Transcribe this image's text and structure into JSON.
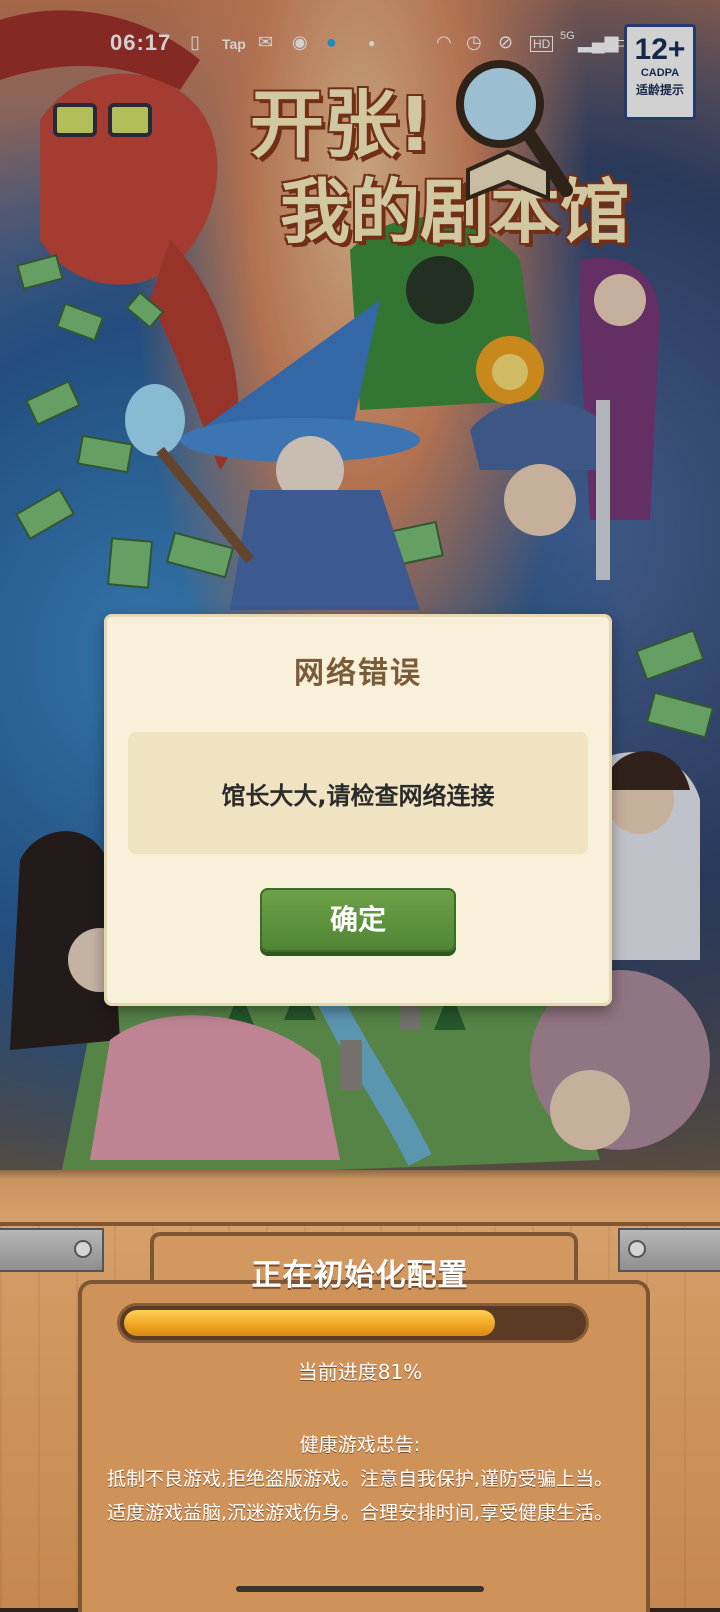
{
  "status_bar": {
    "time": "06:17",
    "left_icons": [
      "listen-app-icon",
      "taptap-icon",
      "wechat-icon",
      "browser-icon",
      "qq-icon",
      "dot-icon"
    ],
    "tap_label": "Tap",
    "right_icons": [
      "headphones-icon",
      "alarm-icon",
      "mute-icon",
      "hd-icon",
      "5g-signal-icon",
      "battery-icon"
    ],
    "hd_label": "HD",
    "network_label": "5G"
  },
  "age_badge": {
    "rating": "12+",
    "org": "CADPA",
    "tip": "适龄提示"
  },
  "game_title": {
    "line1": "开张!",
    "line2": "我的剧本馆"
  },
  "dialog": {
    "title": "网络错误",
    "message": "馆长大大,请检查网络连接",
    "confirm_label": "确定"
  },
  "loading": {
    "title": "正在初始化配置",
    "progress": 0.81,
    "progress_text": "当前进度81%",
    "advice_title": "健康游戏忠告:",
    "advice_line1": "抵制不良游戏,拒绝盗版游戏。注意自我保护,谨防受骗上当。",
    "advice_line2": "适度游戏益脑,沉迷游戏伤身。合理安排时间,享受健康生活。"
  },
  "colors": {
    "dialog_bg": "#f8f0d8",
    "confirm_green": "#5a8f3c",
    "progress_orange": "#f1a722",
    "wood": "#cf965f"
  }
}
